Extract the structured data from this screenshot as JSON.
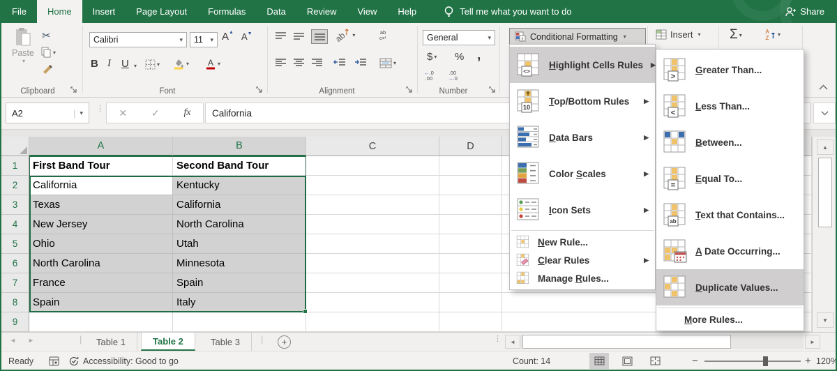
{
  "colors": {
    "accent_green": "#217346",
    "selection_fill": "#d2d2d2",
    "menu_highlight": "#d0cecf",
    "cf_yellow": "#f0c36a"
  },
  "ribbon_tabs": {
    "items": [
      {
        "label": "File",
        "active": false
      },
      {
        "label": "Home",
        "active": true
      },
      {
        "label": "Insert",
        "active": false
      },
      {
        "label": "Page Layout",
        "active": false
      },
      {
        "label": "Formulas",
        "active": false
      },
      {
        "label": "Data",
        "active": false
      },
      {
        "label": "Review",
        "active": false
      },
      {
        "label": "View",
        "active": false
      },
      {
        "label": "Help",
        "active": false
      }
    ]
  },
  "search": {
    "tell_me": "Tell me what you want to do"
  },
  "share_label": "Share",
  "ribbon": {
    "clipboard": {
      "group": "Clipboard",
      "paste": "Paste"
    },
    "font": {
      "group": "Font",
      "family": "Calibri",
      "size": "11",
      "bold": "B",
      "italic": "I",
      "underline": "U"
    },
    "alignment": {
      "group": "Alignment"
    },
    "number": {
      "group": "Number",
      "format": "General",
      "currency": "$",
      "percent": "%",
      "comma": ","
    },
    "styles": {
      "conditional_formatting": "Conditional Formatting"
    },
    "cells": {
      "insert": "Insert"
    },
    "editing": {
      "sigma": "Σ"
    }
  },
  "formula_bar": {
    "name_box": "A2",
    "fx": "fx",
    "value": "California"
  },
  "cf_menu": {
    "items": [
      {
        "pre": "",
        "key": "H",
        "rest": "ighlight Cells Rules",
        "icon": "hcr",
        "big": true,
        "submenu": true,
        "selected": true
      },
      {
        "pre": "",
        "key": "T",
        "rest": "op/Bottom Rules",
        "icon": "tb",
        "big": true,
        "submenu": true
      },
      {
        "pre": "",
        "key": "D",
        "rest": "ata Bars",
        "icon": "db",
        "big": true,
        "submenu": true
      },
      {
        "pre": "Color ",
        "key": "S",
        "rest": "cales",
        "icon": "cs",
        "big": true,
        "submenu": true
      },
      {
        "pre": "",
        "key": "I",
        "rest": "con Sets",
        "icon": "is",
        "big": true,
        "submenu": true
      },
      {
        "sep": true
      },
      {
        "pre": "",
        "key": "N",
        "rest": "ew Rule...",
        "icon": "newr",
        "big": false
      },
      {
        "pre": "",
        "key": "C",
        "rest": "lear Rules",
        "icon": "clear",
        "big": false,
        "submenu": true
      },
      {
        "pre": "Manage ",
        "key": "R",
        "rest": "ules...",
        "icon": "manage",
        "big": false
      }
    ]
  },
  "cf_submenu": {
    "items": [
      {
        "pre": "",
        "key": "G",
        "rest": "reater Than...",
        "icon": "gt",
        "big": true
      },
      {
        "pre": "",
        "key": "L",
        "rest": "ess Than...",
        "icon": "lt",
        "big": true
      },
      {
        "pre": "",
        "key": "B",
        "rest": "etween...",
        "icon": "between",
        "big": true
      },
      {
        "pre": "",
        "key": "E",
        "rest": "qual To...",
        "icon": "eq",
        "big": true
      },
      {
        "pre": "",
        "key": "T",
        "rest": "ext that Contains...",
        "icon": "txt",
        "big": true
      },
      {
        "pre": "",
        "key": "A",
        "rest": " Date Occurring...",
        "icon": "date",
        "big": true
      },
      {
        "pre": "",
        "key": "D",
        "rest": "uplicate Values...",
        "icon": "dup",
        "big": true,
        "selected": true
      },
      {
        "sep": true
      },
      {
        "pre": "",
        "key": "M",
        "rest": "ore Rules...",
        "icon": "",
        "big": false
      }
    ]
  },
  "grid": {
    "columns": [
      "A",
      "B",
      "C",
      "D"
    ],
    "row_numbers": [
      "1",
      "2",
      "3",
      "4",
      "5",
      "6",
      "7",
      "8",
      "9"
    ],
    "header_row": [
      "First Band Tour",
      "Second Band Tour"
    ],
    "data_rows": [
      [
        "California",
        "Kentucky"
      ],
      [
        "Texas",
        "California"
      ],
      [
        "New Jersey",
        "North Carolina"
      ],
      [
        "Ohio",
        "Utah"
      ],
      [
        "North Carolina",
        "Minnesota"
      ],
      [
        "France",
        "Spain"
      ],
      [
        "Spain",
        "Italy"
      ]
    ],
    "active_cell": "A2"
  },
  "sheet_bar": {
    "tabs": [
      {
        "label": "Table 1",
        "active": false
      },
      {
        "label": "Table 2",
        "active": true
      },
      {
        "label": "Table 3",
        "active": false
      }
    ]
  },
  "status_bar": {
    "mode": "Ready",
    "accessibility": "Accessibility: Good to go",
    "count": "Count: 14",
    "zoom_level": "120%"
  }
}
